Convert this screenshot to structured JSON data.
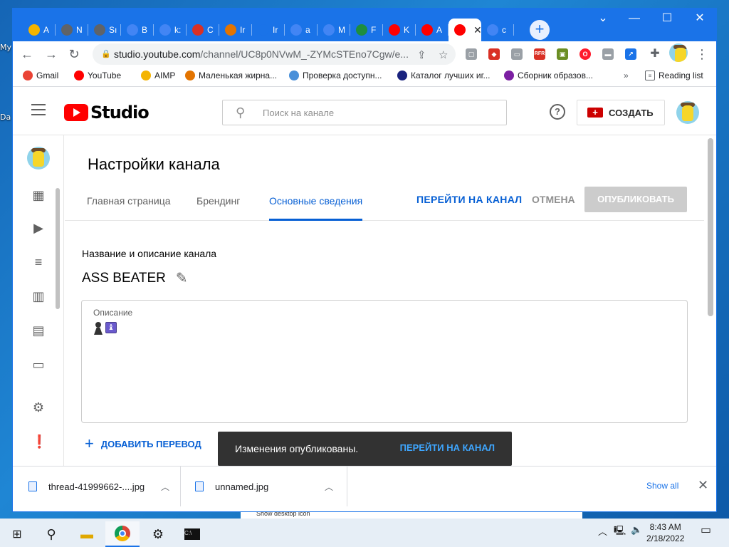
{
  "desktop": {
    "label_top": "My",
    "label_mid": "Da",
    "strip_text": "Show desktop icon"
  },
  "browser": {
    "tabs": [
      {
        "icon": "aimp-icon",
        "label": "A",
        "color": "#f4b400"
      },
      {
        "icon": "chromium-icon",
        "label": "N",
        "color": "#5f6368"
      },
      {
        "icon": "gear-icon",
        "label": "Sı",
        "color": "#5f6368"
      },
      {
        "icon": "google-icon",
        "label": "B",
        "color": "#4285f4"
      },
      {
        "icon": "google-icon",
        "label": "k:",
        "color": "#4285f4"
      },
      {
        "icon": "down-arrow-icon",
        "label": "C",
        "color": "#d93025"
      },
      {
        "icon": "image-icon",
        "label": "Ir",
        "color": "#e37400"
      },
      {
        "icon": "download-icon",
        "label": "Ir",
        "color": "#1a73e8"
      },
      {
        "icon": "google-icon",
        "label": "a",
        "color": "#4285f4"
      },
      {
        "icon": "google-icon",
        "label": "M",
        "color": "#4285f4"
      },
      {
        "icon": "upload-icon",
        "label": "F",
        "color": "#1e8e3e"
      },
      {
        "icon": "youtube-icon",
        "label": "K",
        "color": "#ff0000"
      },
      {
        "icon": "youtube-icon",
        "label": "A",
        "color": "#ff0000"
      },
      {
        "icon": "youtube-icon",
        "label": "",
        "color": "#ff0000",
        "active": true
      },
      {
        "icon": "google-icon",
        "label": "c",
        "color": "#4285f4"
      }
    ],
    "url_host": "studio.youtube.com",
    "url_path": "/channel/UC8p0NVwM_-ZYMcSTEno7Cgw/e...",
    "bookmarks": [
      {
        "label": "Gmail",
        "icon": "gmail-icon"
      },
      {
        "label": "YouTube",
        "icon": "youtube-icon"
      },
      {
        "label": "AIMP",
        "icon": "aimp-icon"
      },
      {
        "label": "Маленькая жирна...",
        "icon": "fox-icon"
      },
      {
        "label": "Проверка доступн...",
        "icon": "gear-icon"
      },
      {
        "label": "Каталог лучших иг...",
        "icon": "catalog-icon"
      },
      {
        "label": "Сборник образов...",
        "icon": "ms-icon"
      }
    ],
    "reading_list": "Reading list",
    "more_bookmarks": "»"
  },
  "studio": {
    "logo_text": "Studio",
    "search_placeholder": "Поиск на канале",
    "help_label": "?",
    "create_label": "СОЗДАТЬ",
    "page_title": "Настройки канала",
    "tabs": [
      "Главная страница",
      "Брендинг",
      "Основные сведения"
    ],
    "goto_channel": "ПЕРЕЙТИ НА КАНАЛ",
    "cancel": "ОТМЕНА",
    "publish": "ОПУБЛИКОВАТЬ",
    "section_title": "Название и описание канала",
    "channel_name": "ASS BEATER",
    "description_label": "Описание",
    "description_emoji": "♝",
    "add_translation": "ДОБАВИТЬ ПЕРЕВОД",
    "snackbar_text": "Изменения опубликованы.",
    "snackbar_action": "ПЕРЕЙТИ НА КАНАЛ"
  },
  "downloads": {
    "items": [
      "thread-41999662-....jpg",
      "unnamed.jpg"
    ],
    "show_all": "Show all"
  },
  "taskbar": {
    "time": "8:43 AM",
    "date": "2/18/2022"
  }
}
